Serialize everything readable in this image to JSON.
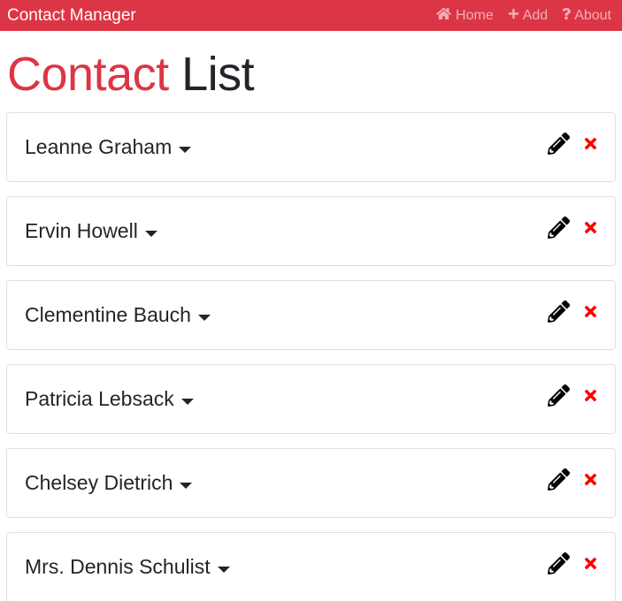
{
  "navbar": {
    "brand": "Contact Manager",
    "links": [
      {
        "label": "Home",
        "icon": "home-icon"
      },
      {
        "label": "Add",
        "icon": "plus-icon"
      },
      {
        "label": "About",
        "icon": "question-icon"
      }
    ]
  },
  "title": {
    "accent": "Contact",
    "rest": "List"
  },
  "contacts": [
    {
      "name": "Leanne Graham"
    },
    {
      "name": "Ervin Howell"
    },
    {
      "name": "Clementine Bauch"
    },
    {
      "name": "Patricia Lebsack"
    },
    {
      "name": "Chelsey Dietrich"
    },
    {
      "name": "Mrs. Dennis Schulist"
    }
  ],
  "colors": {
    "brand": "#dc3545",
    "delete": "#ff0000",
    "edit": "#000000"
  },
  "icons": {
    "toggle": "caret-down-icon",
    "edit": "pencil-icon",
    "delete": "times-icon"
  }
}
